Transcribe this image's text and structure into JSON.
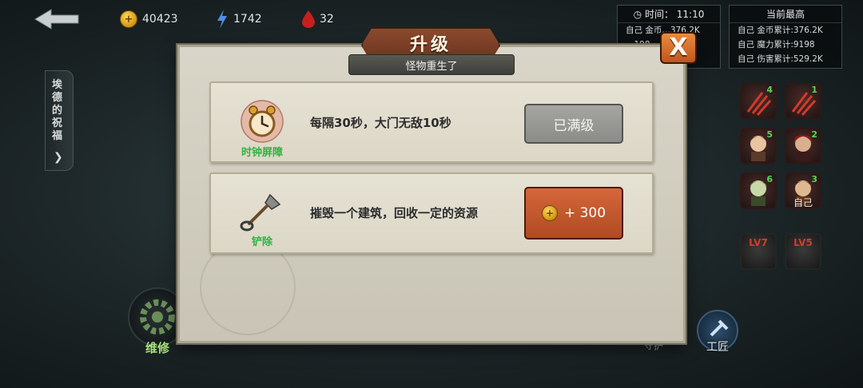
{
  "top_bar": {
    "gold": "40423",
    "mana": "1742",
    "blood": "32"
  },
  "time_panel": {
    "label": "时间：",
    "time": "11:10",
    "rows": [
      "自己 金币…376.2K",
      "…198",
      "…29.2K"
    ]
  },
  "best_panel": {
    "title": "当前最高",
    "rows": [
      "自己 金币累计:376.2K",
      "自己 魔力累计:9198",
      "自己 伤害累计:529.2K"
    ]
  },
  "blessing_tab": {
    "label": "埃德的祝福"
  },
  "unit_cards": [
    {
      "num": "4",
      "label": "",
      "lv": ""
    },
    {
      "num": "1",
      "label": "",
      "lv": ""
    },
    {
      "num": "5",
      "label": "",
      "lv": ""
    },
    {
      "num": "2",
      "label": "",
      "lv": ""
    },
    {
      "num": "6",
      "label": "",
      "lv": ""
    },
    {
      "num": "3",
      "label": "自己",
      "lv": ""
    },
    {
      "num": "",
      "label": "",
      "lv": "LV7"
    },
    {
      "num": "",
      "label": "",
      "lv": "LV5"
    }
  ],
  "dialog": {
    "title": "升级",
    "subtitle": "怪物重生了",
    "close_label": "X",
    "items": [
      {
        "name": "时钟屏障",
        "desc": "每隔30秒，大门无敌10秒",
        "button": "已满级"
      },
      {
        "name": "铲除",
        "desc": "摧毁一个建筑，回收一定的资源",
        "button": "+ 300"
      }
    ]
  },
  "bottom": {
    "repair_label": "维修",
    "guard_label": "守护",
    "craft_label": "工匠"
  },
  "colors": {
    "accent_orange": "#c0561c",
    "item_name_green": "#2fb344",
    "parchment": "#d9d5c8"
  }
}
